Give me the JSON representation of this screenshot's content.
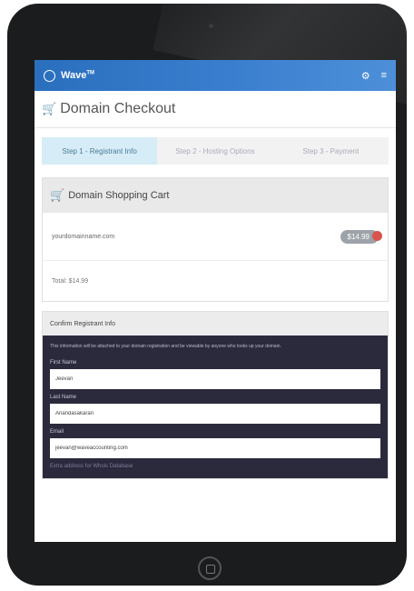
{
  "app": {
    "brand": "Wave",
    "brand_sup": "TM"
  },
  "page": {
    "title": "Domain Checkout"
  },
  "steps": [
    {
      "label": "Step 1 - Registrant Info",
      "active": true
    },
    {
      "label": "Step 2 - Hosting Options",
      "active": false
    },
    {
      "label": "Step 3 - Payment",
      "active": false
    }
  ],
  "cart": {
    "heading": "Domain Shopping Cart",
    "domain": "yourdomainname.com",
    "price": "$14.99",
    "total": "Total: $14.99"
  },
  "registrant": {
    "heading": "Confirm Registrant Info",
    "notice": "This information will be attached to your domain registration and be viewable by anyone who looks up your domain.",
    "first_name_label": "First Name",
    "first_name_value": "Jeevan",
    "last_name_label": "Last Name",
    "last_name_value": "Anandasakaran",
    "email_label": "Email",
    "email_value": "jeevan@waveaccounting.com",
    "next_label": "Extra address for Whois Database"
  },
  "colors": {
    "accent": "#2a6fbe",
    "active_step": "#d6ecf6",
    "dark_panel": "#2b2a3d",
    "remove": "#d9534f"
  }
}
